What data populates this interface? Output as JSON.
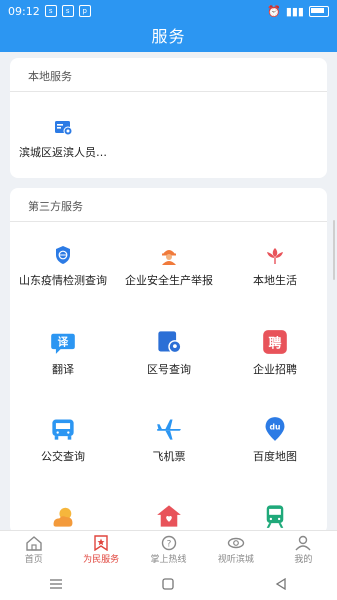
{
  "statusbar": {
    "time": "09:12",
    "battery": "BAT"
  },
  "header": {
    "title": "服务"
  },
  "local_services": {
    "title": "本地服务",
    "items": [
      {
        "label": "滨城区返滨人员…",
        "icon": "id-card-icon"
      }
    ]
  },
  "third_services": {
    "title": "第三方服务",
    "items": [
      {
        "label": "山东疫情检测查询",
        "icon": "shield-icon"
      },
      {
        "label": "企业安全生产举报",
        "icon": "worker-icon"
      },
      {
        "label": "本地生活",
        "icon": "lotus-icon"
      },
      {
        "label": "翻译",
        "icon": "translate-icon",
        "glyph": "译"
      },
      {
        "label": "区号查询",
        "icon": "area-code-icon"
      },
      {
        "label": "企业招聘",
        "icon": "recruit-icon",
        "glyph": "聘"
      },
      {
        "label": "公交查询",
        "icon": "bus-icon"
      },
      {
        "label": "飞机票",
        "icon": "airplane-icon"
      },
      {
        "label": "百度地图",
        "icon": "baidu-map-icon",
        "glyph": "du"
      }
    ]
  },
  "tabbar": {
    "tabs": [
      {
        "label": "首页",
        "icon": "home-icon"
      },
      {
        "label": "为民服务",
        "icon": "star-flag-icon",
        "active": true
      },
      {
        "label": "掌上热线",
        "icon": "question-icon"
      },
      {
        "label": "视听滨城",
        "icon": "eye-icon"
      },
      {
        "label": "我的",
        "icon": "user-icon"
      }
    ]
  },
  "colors": {
    "primary": "#2c96f2",
    "active_tab": "#e0453d"
  }
}
